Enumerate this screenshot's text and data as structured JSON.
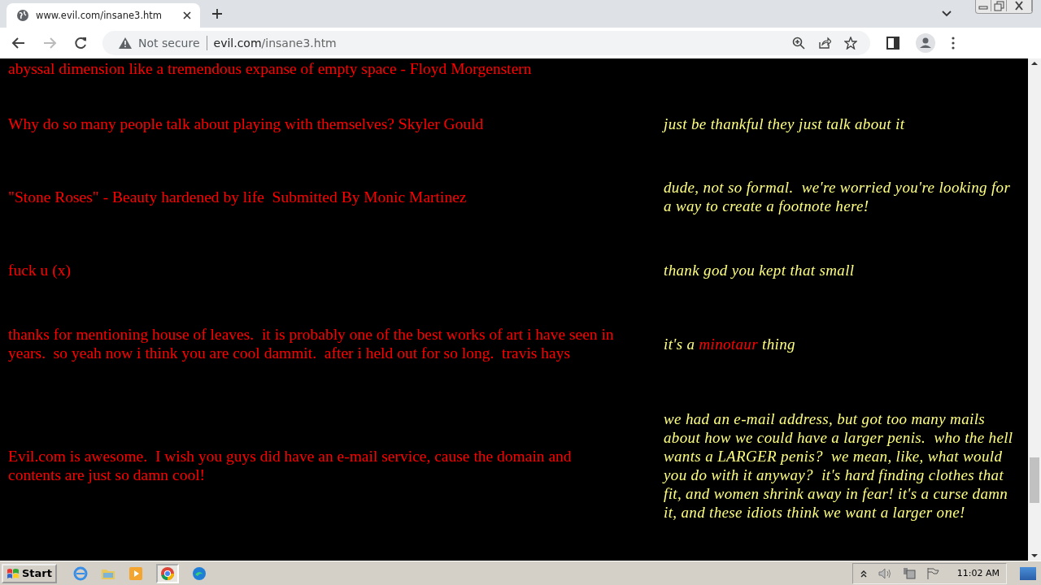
{
  "browser": {
    "tab_title": "www.evil.com/insane3.htm",
    "security": "Not secure",
    "url_domain": "evil.com",
    "url_path": "/insane3.htm"
  },
  "page": {
    "rows": [
      {
        "comment": "abyssal dimension like a tremendous expanse of empty space - Floyd Morgenstern",
        "reply": []
      },
      {
        "comment": "Why do so many people talk about playing with themselves? Skyler Gould",
        "reply": [
          {
            "text": "just be thankful they just talk about it",
            "highlight": false
          }
        ]
      },
      {
        "comment": "\"Stone Roses\" - Beauty hardened by life  Submitted By Monic Martinez",
        "reply": [
          {
            "text": "dude, not so formal.  we're worried you're looking for a way to create a footnote here!",
            "highlight": false
          }
        ]
      },
      {
        "comment": "fuck u (x)",
        "reply": [
          {
            "text": "thank god you kept that small",
            "highlight": false
          }
        ]
      },
      {
        "comment": "thanks for mentioning house of leaves.  it is probably one of the best works of art i have seen in years.  so yeah now i think you are cool dammit.  after i held out for so long.  travis hays",
        "reply": [
          {
            "text": "it's a ",
            "highlight": false
          },
          {
            "text": "minotaur",
            "highlight": true
          },
          {
            "text": " thing",
            "highlight": false
          }
        ]
      },
      {
        "comment": "Evil.com is awesome.  I wish you guys did have an e-mail service, cause the domain and contents are just so damn cool!",
        "reply": [
          {
            "text": "we had an e-mail address, but got too many mails about how we could have a larger penis.  who the hell wants a LARGER penis?  we mean, like, what would you do with it anyway?  it's hard finding clothes that fit, and women shrink away in fear! it's a curse damn it, and these idiots think we want a larger one!",
            "highlight": false
          }
        ]
      }
    ]
  },
  "taskbar": {
    "start": "Start",
    "clock": "11:02 AM"
  }
}
